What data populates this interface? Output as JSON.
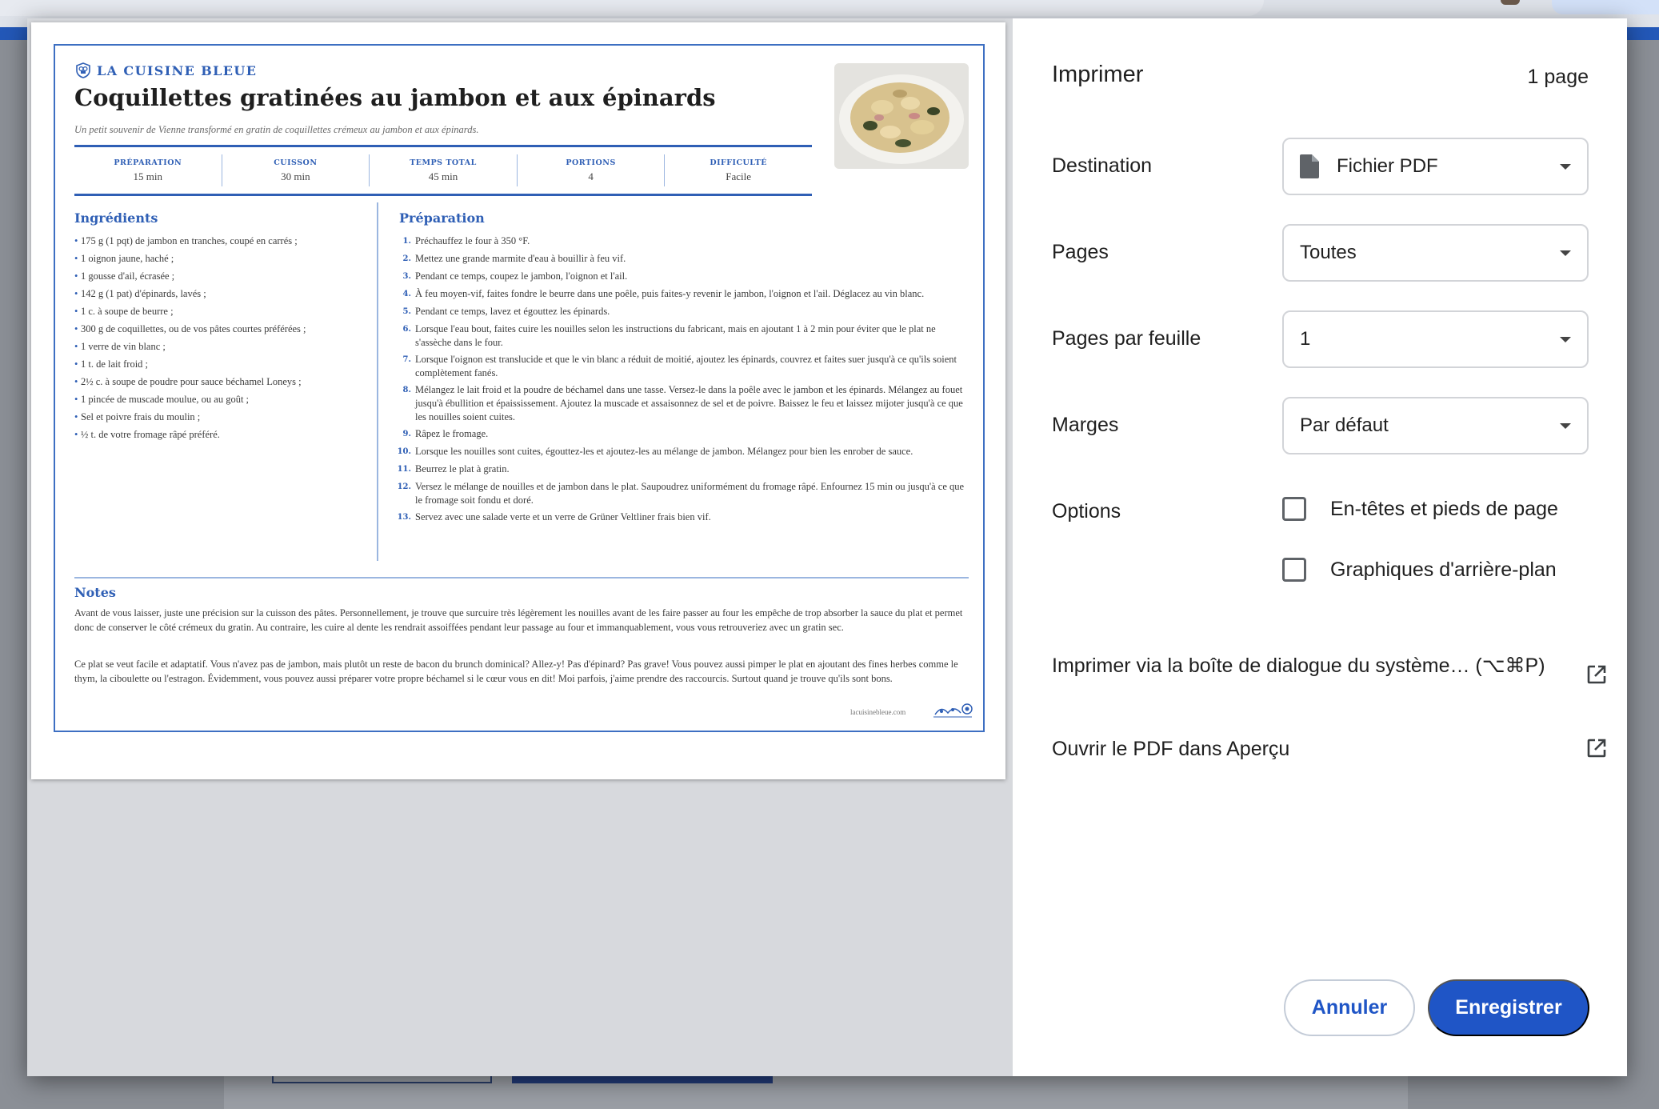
{
  "print_dialog": {
    "title": "Imprimer",
    "page_count": "1 page",
    "destination": {
      "label": "Destination",
      "value": "Fichier PDF"
    },
    "pages": {
      "label": "Pages",
      "value": "Toutes"
    },
    "pages_per_sheet": {
      "label": "Pages par feuille",
      "value": "1"
    },
    "margins": {
      "label": "Marges",
      "value": "Par défaut"
    },
    "options": {
      "label": "Options",
      "headers_footers": {
        "label": "En-têtes et pieds de page",
        "checked": false
      },
      "background_graphics": {
        "label": "Graphiques d'arrière-plan",
        "checked": false
      }
    },
    "system_dialog_link": "Imprimer via la boîte de dialogue du système… (⌥⌘P)",
    "open_preview_link": "Ouvrir le PDF dans Aperçu",
    "cancel_label": "Annuler",
    "save_label": "Enregistrer",
    "accent_color": "#1f55c6"
  },
  "recipe": {
    "brand": "LA CUISINE BLEUE",
    "title": "Coquillettes gratinées au jambon et aux épinards",
    "subtitle": "Un petit souvenir de Vienne transformé en gratin de coquillettes crémeux au jambon et aux épinards.",
    "stats": [
      {
        "label": "PRÉPARATION",
        "value": "15 min"
      },
      {
        "label": "CUISSON",
        "value": "30 min"
      },
      {
        "label": "TEMPS TOTAL",
        "value": "45 min"
      },
      {
        "label": "PORTIONS",
        "value": "4"
      },
      {
        "label": "DIFFICULTÉ",
        "value": "Facile"
      }
    ],
    "ingredients_heading": "Ingrédients",
    "ingredients": [
      "175 g (1 pqt) de jambon en tranches, coupé en carrés ;",
      "1 oignon jaune, haché ;",
      "1 gousse d'ail, écrasée ;",
      "142 g (1 pat) d'épinards, lavés ;",
      "1 c. à soupe de beurre ;",
      "300 g de coquillettes, ou de vos pâtes courtes préférées ;",
      "1 verre de vin blanc ;",
      "1 t. de lait froid ;",
      "2½ c. à soupe de poudre pour sauce béchamel Loneys ;",
      "1 pincée de muscade moulue, ou au goût ;",
      "Sel et poivre frais du moulin ;",
      "½ t. de votre fromage râpé préféré."
    ],
    "preparation_heading": "Préparation",
    "steps": [
      {
        "n": "1.",
        "text": "Préchauffez le four à 350 °F."
      },
      {
        "n": "2.",
        "text": "Mettez une grande marmite d'eau à bouillir à feu vif."
      },
      {
        "n": "3.",
        "text": "Pendant ce temps, coupez le jambon, l'oignon et l'ail."
      },
      {
        "n": "4.",
        "text": "À feu moyen-vif, faites fondre le beurre dans une poêle, puis faites-y revenir le jambon, l'oignon et l'ail. Déglacez au vin blanc."
      },
      {
        "n": "5.",
        "text": "Pendant ce temps, lavez et égouttez les épinards."
      },
      {
        "n": "6.",
        "text": "Lorsque l'eau bout, faites cuire les nouilles selon les instructions du fabricant, mais en ajoutant 1 à 2 min pour éviter que le plat ne s'assèche dans le four."
      },
      {
        "n": "7.",
        "text": "Lorsque l'oignon est translucide et que le vin blanc a réduit de moitié, ajoutez les épinards, couvrez et faites suer jusqu'à ce qu'ils soient complètement fanés."
      },
      {
        "n": "8.",
        "text": "Mélangez le lait froid et la poudre de béchamel dans une tasse. Versez-le dans la poêle avec le jambon et les épinards. Mélangez au fouet jusqu'à ébullition et épaississement. Ajoutez la muscade et assaisonnez de sel et de poivre. Baissez le feu et laissez mijoter jusqu'à ce que les nouilles soient cuites."
      },
      {
        "n": "9.",
        "text": "Râpez le fromage."
      },
      {
        "n": "10.",
        "text": "Lorsque les nouilles sont cuites, égouttez-les et ajoutez-les au mélange de jambon. Mélangez pour bien les enrober de sauce."
      },
      {
        "n": "11.",
        "text": "Beurrez le plat à gratin."
      },
      {
        "n": "12.",
        "text": "Versez le mélange de nouilles et de jambon dans le plat. Saupoudrez uniformément du fromage râpé. Enfournez 15 min ou jusqu'à ce que le fromage soit fondu et doré."
      },
      {
        "n": "13.",
        "text": "Servez avec une salade verte et un verre de Grüner Veltliner frais bien vif."
      }
    ],
    "notes_heading": "Notes",
    "notes": [
      "Avant de vous laisser, juste une précision sur la cuisson des pâtes. Personnellement, je trouve que surcuire très légèrement les nouilles avant de les faire passer au four les empêche de trop absorber la sauce du plat et permet donc de conserver le côté crémeux du gratin. Au contraire, les cuire al dente les rendrait assoiffées pendant leur passage au four et immanquablement, vous vous retrouveriez avec un gratin sec.",
      "Ce plat se veut facile et adaptatif. Vous n'avez pas de jambon, mais plutôt un reste de bacon du brunch dominical? Allez-y! Pas d'épinard? Pas grave! Vous pouvez aussi pimper le plat en ajoutant des fines herbes comme le thym, la ciboulette ou l'estragon. Évidemment, vous pouvez aussi préparer votre propre béchamel si le cœur vous en dit! Moi parfois, j'aime prendre des raccourcis. Surtout quand je trouve qu'ils sont bons."
    ],
    "site": "lacuisinebleue.com",
    "brand_color": "#2f5fb5"
  }
}
